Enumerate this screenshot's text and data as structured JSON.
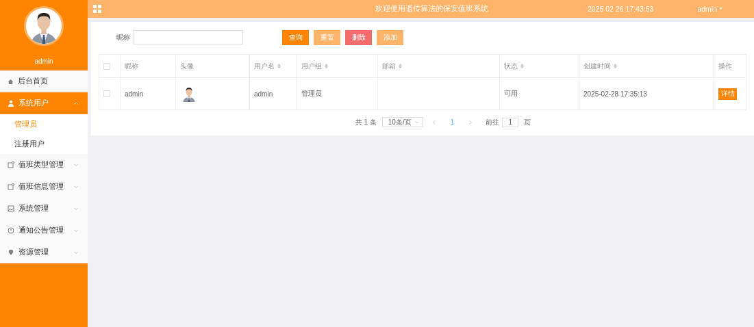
{
  "sidebar": {
    "username": "admin",
    "menu": [
      {
        "label": "后台首页",
        "selected": false
      },
      {
        "label": "系统用户",
        "selected": true,
        "expanded": true,
        "children": [
          {
            "label": "管理员",
            "selected": true
          },
          {
            "label": "注册用户",
            "selected": false
          }
        ]
      },
      {
        "label": "值班类型管理",
        "selected": false,
        "expanded": false
      },
      {
        "label": "值班信息管理",
        "selected": false,
        "expanded": false
      },
      {
        "label": "系统管理",
        "selected": false,
        "expanded": false
      },
      {
        "label": "通知公告管理",
        "selected": false,
        "expanded": false
      },
      {
        "label": "资源管理",
        "selected": false,
        "expanded": false
      }
    ]
  },
  "header": {
    "title": "欢迎使用遗传算法的保安值班系统",
    "datetime": "2025 02 26 17:43:53",
    "user": "admin"
  },
  "search": {
    "label": "昵称",
    "buttons": [
      {
        "label": "查询",
        "kind": "primary"
      },
      {
        "label": "重置",
        "kind": "light"
      },
      {
        "label": "删除",
        "kind": "danger"
      },
      {
        "label": "添加",
        "kind": "light"
      }
    ]
  },
  "table": {
    "select_all_checked": false,
    "columns": [
      {
        "label": "昵称",
        "sortable": false
      },
      {
        "label": "头像",
        "sortable": false
      },
      {
        "label": "用户名",
        "sortable": true
      },
      {
        "label": "用户组",
        "sortable": true
      },
      {
        "label": "邮箱",
        "sortable": true
      },
      {
        "label": "状态",
        "sortable": true
      },
      {
        "label": "创建时间",
        "sortable": true
      },
      {
        "label": "操作",
        "sortable": false
      }
    ],
    "rows": [
      {
        "checked": false,
        "cells": [
          "admin",
          {
            "kind": "picture"
          },
          "admin",
          "管理员",
          "",
          "可用",
          "2025-02-28 17:35:13"
        ],
        "action": "详情"
      }
    ]
  },
  "pagination": {
    "total": "共 1 条",
    "page_size": "10条/页",
    "pages": [
      {
        "label": "1",
        "selected": true
      }
    ],
    "goto_label": "前往",
    "goto_value": "1",
    "goto_suffix": "页"
  }
}
